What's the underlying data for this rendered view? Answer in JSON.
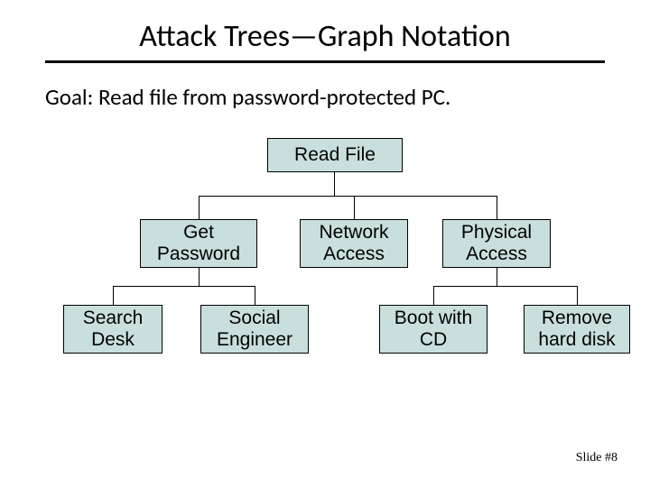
{
  "title": "Attack Trees—Graph Notation",
  "goal": "Goal: Read file from password-protected PC.",
  "nodes": {
    "root": "Read File",
    "l1a": "Get Password",
    "l1b": "Network Access",
    "l1c": "Physical Access",
    "l2a": "Search Desk",
    "l2b": "Social Engineer",
    "l2c": "Boot with CD",
    "l2d": "Remove hard disk"
  },
  "footer": "Slide #8"
}
